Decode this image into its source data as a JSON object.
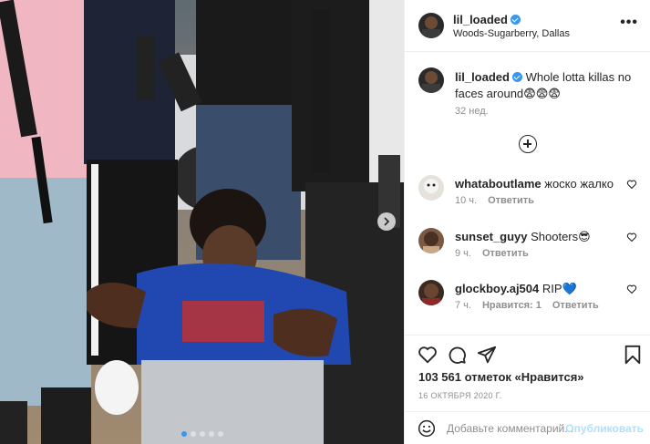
{
  "post": {
    "author": "lil_loaded",
    "location": "Woods-Sugarberry, Dallas",
    "more_label": "•••"
  },
  "caption": {
    "author": "lil_loaded",
    "text": "Whole lotta killas no faces around😨😨😨",
    "time": "32 нед."
  },
  "comments": [
    {
      "user": "whataboutlame",
      "text": "жоско жалко",
      "time": "10 ч.",
      "likes": "",
      "reply_label": "Ответить"
    },
    {
      "user": "sunset_guyy",
      "text": "Shooters😎",
      "time": "9 ч.",
      "likes": "",
      "reply_label": "Ответить"
    },
    {
      "user": "glockboy.aj504",
      "text": "RIP💙",
      "time": "7 ч.",
      "likes": "Нравится: 1",
      "reply_label": "Ответить"
    }
  ],
  "engagement": {
    "likes_text": "103 561 отметок «Нравится»",
    "date": "16 ОКТЯБРЯ 2020 Г."
  },
  "add_comment": {
    "placeholder": "Добавьте комментарий...",
    "publish_label": "Опубликовать"
  },
  "carousel": {
    "count": 5,
    "active": 0
  },
  "icons": {
    "more": "more-options-icon",
    "verified": "verified-badge-icon",
    "load_more": "plus-circle-icon",
    "like": "heart-icon",
    "comment": "comment-bubble-icon",
    "share": "paper-plane-icon",
    "save": "bookmark-icon",
    "emoji": "smiley-icon",
    "next": "chevron-right-icon"
  },
  "colors": {
    "accent": "#3897f0",
    "publish_disabled": "#b2dffc",
    "muted": "#8e8e8e"
  }
}
